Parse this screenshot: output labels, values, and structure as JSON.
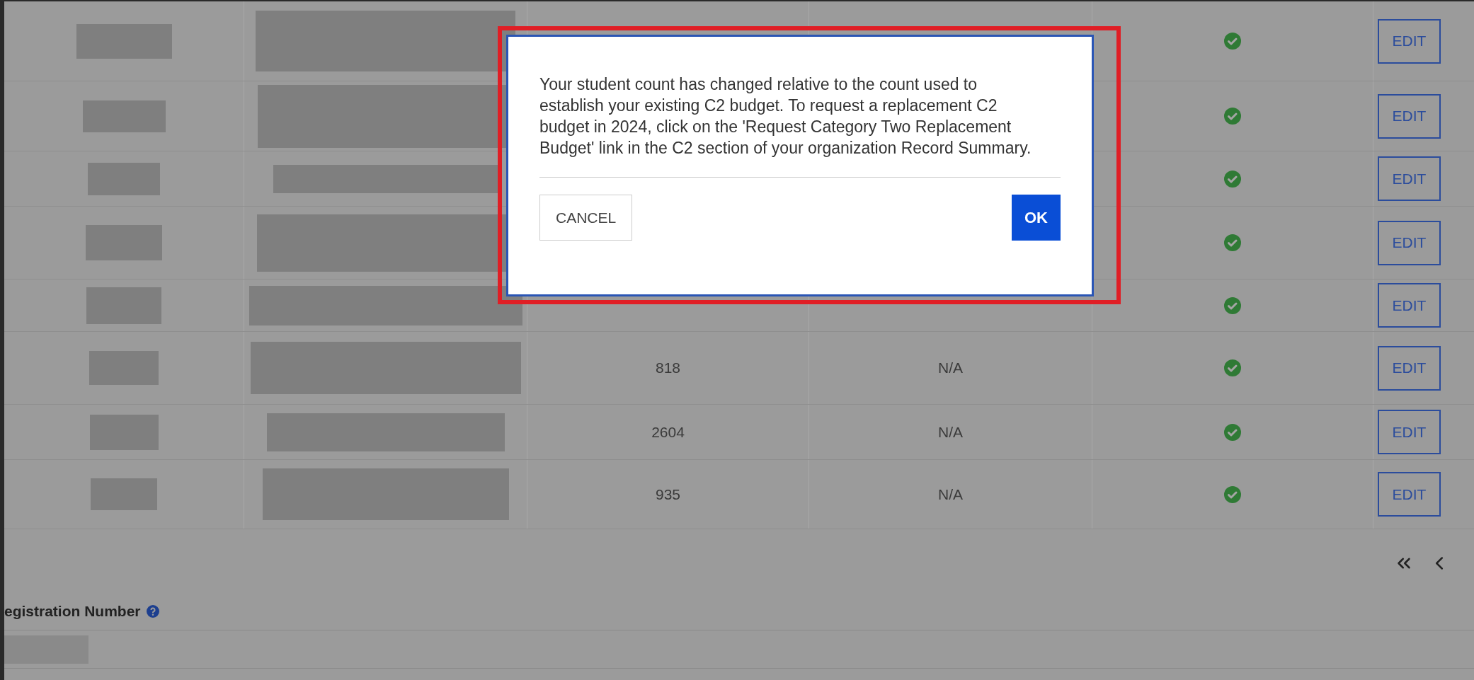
{
  "table": {
    "rows": [
      {
        "verified": true,
        "action": "EDIT"
      },
      {
        "verified": true,
        "action": "EDIT"
      },
      {
        "verified": true,
        "action": "EDIT"
      },
      {
        "verified": true,
        "action": "EDIT"
      },
      {
        "verified": true,
        "action": "EDIT"
      },
      {
        "count": "818",
        "value": "N/A",
        "verified": true,
        "action": "EDIT"
      },
      {
        "count": "2604",
        "value": "N/A",
        "verified": true,
        "action": "EDIT"
      },
      {
        "count": "935",
        "value": "N/A",
        "verified": true,
        "action": "EDIT"
      }
    ]
  },
  "section": {
    "label": "egistration Number"
  },
  "dialog": {
    "message": "Your student count has changed relative to the count used to establish your existing C2 budget. To request a replacement C2 budget in 2024, click on the 'Request Category Two Replacement Budget' link in the C2 section of your organization Record Summary.",
    "highlighted": true,
    "buttons": [
      {
        "label": "CANCEL",
        "kind": "secondary"
      },
      {
        "label": "OK",
        "kind": "primary"
      }
    ]
  }
}
